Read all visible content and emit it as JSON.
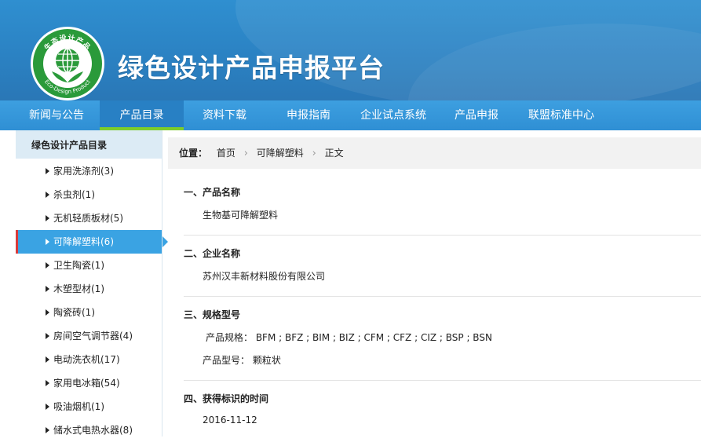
{
  "header": {
    "title": "绿色设计产品申报平台",
    "logo": {
      "top_text": "生态设计产品",
      "bottom_text": "Eco-Design Product",
      "icon": "globe-leaf-logo"
    }
  },
  "colors": {
    "header_blue": "#2b82c3",
    "nav_blue": "#3d9fe0",
    "active_green": "#7dcd2a",
    "sidebar_active": "#3aa3e3",
    "logo_green": "#2a9a3a"
  },
  "nav": {
    "items": [
      {
        "label": "新闻与公告"
      },
      {
        "label": "产品目录",
        "active": true
      },
      {
        "label": "资料下载"
      },
      {
        "label": "申报指南"
      },
      {
        "label": "企业试点系统"
      },
      {
        "label": "产品申报"
      },
      {
        "label": "联盟标准中心"
      }
    ]
  },
  "sidebar": {
    "title": "绿色设计产品目录",
    "items": [
      {
        "label": "家用洗涤剂(3)"
      },
      {
        "label": "杀虫剂(1)"
      },
      {
        "label": "无机轻质板材(5)"
      },
      {
        "label": "可降解塑料(6)",
        "active": true
      },
      {
        "label": "卫生陶瓷(1)"
      },
      {
        "label": "木塑型材(1)"
      },
      {
        "label": "陶瓷砖(1)"
      },
      {
        "label": "房间空气调节器(4)"
      },
      {
        "label": "电动洗衣机(17)"
      },
      {
        "label": "家用电冰箱(54)"
      },
      {
        "label": "吸油烟机(1)"
      },
      {
        "label": "储水式电热水器(8)"
      }
    ]
  },
  "breadcrumb": {
    "label": "位置：",
    "items": [
      "首页",
      "可降解塑料",
      "正文"
    ],
    "separator": "›"
  },
  "article": {
    "sections": [
      {
        "title": "一、产品名称",
        "lines": [
          "生物基可降解塑料"
        ]
      },
      {
        "title": "二、企业名称",
        "lines": [
          "苏州汉丰新材料股份有限公司"
        ]
      },
      {
        "title": "三、规格型号",
        "lines": [
          "产品规格： BFM ; BFZ ; BIM ; BIZ ; CFM ; CFZ ; CIZ ; BSP ; BSN",
          "产品型号： 颗粒状"
        ]
      },
      {
        "title": "四、获得标识的时间",
        "lines": [
          "2016-11-12"
        ]
      }
    ]
  }
}
